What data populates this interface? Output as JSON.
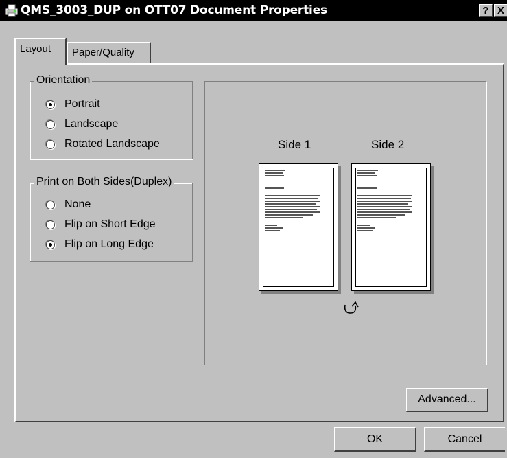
{
  "window": {
    "title": "QMS_3003_DUP on OTT07 Document Properties",
    "help_button": "?",
    "close_button": "X"
  },
  "tabs": [
    {
      "label": "Layout",
      "selected": true
    },
    {
      "label": "Paper/Quality",
      "selected": false
    }
  ],
  "orientation": {
    "label": "Orientation",
    "options": [
      {
        "label": "Portrait",
        "checked": true
      },
      {
        "label": "Landscape",
        "checked": false
      },
      {
        "label": "Rotated Landscape",
        "checked": false
      }
    ]
  },
  "duplex": {
    "label": "Print on Both Sides(Duplex)",
    "options": [
      {
        "label": "None",
        "checked": false
      },
      {
        "label": "Flip on Short Edge",
        "checked": false
      },
      {
        "label": "Flip on Long Edge",
        "checked": true
      }
    ]
  },
  "preview": {
    "side1_label": "Side 1",
    "side2_label": "Side 2",
    "flip_icon": "rotate-arrow-icon"
  },
  "buttons": {
    "advanced": "Advanced...",
    "ok": "OK",
    "cancel": "Cancel"
  },
  "colors": {
    "dialog_bg": "#c0c0c0",
    "titlebar_bg": "#000000",
    "title_text": "#ffffff"
  }
}
